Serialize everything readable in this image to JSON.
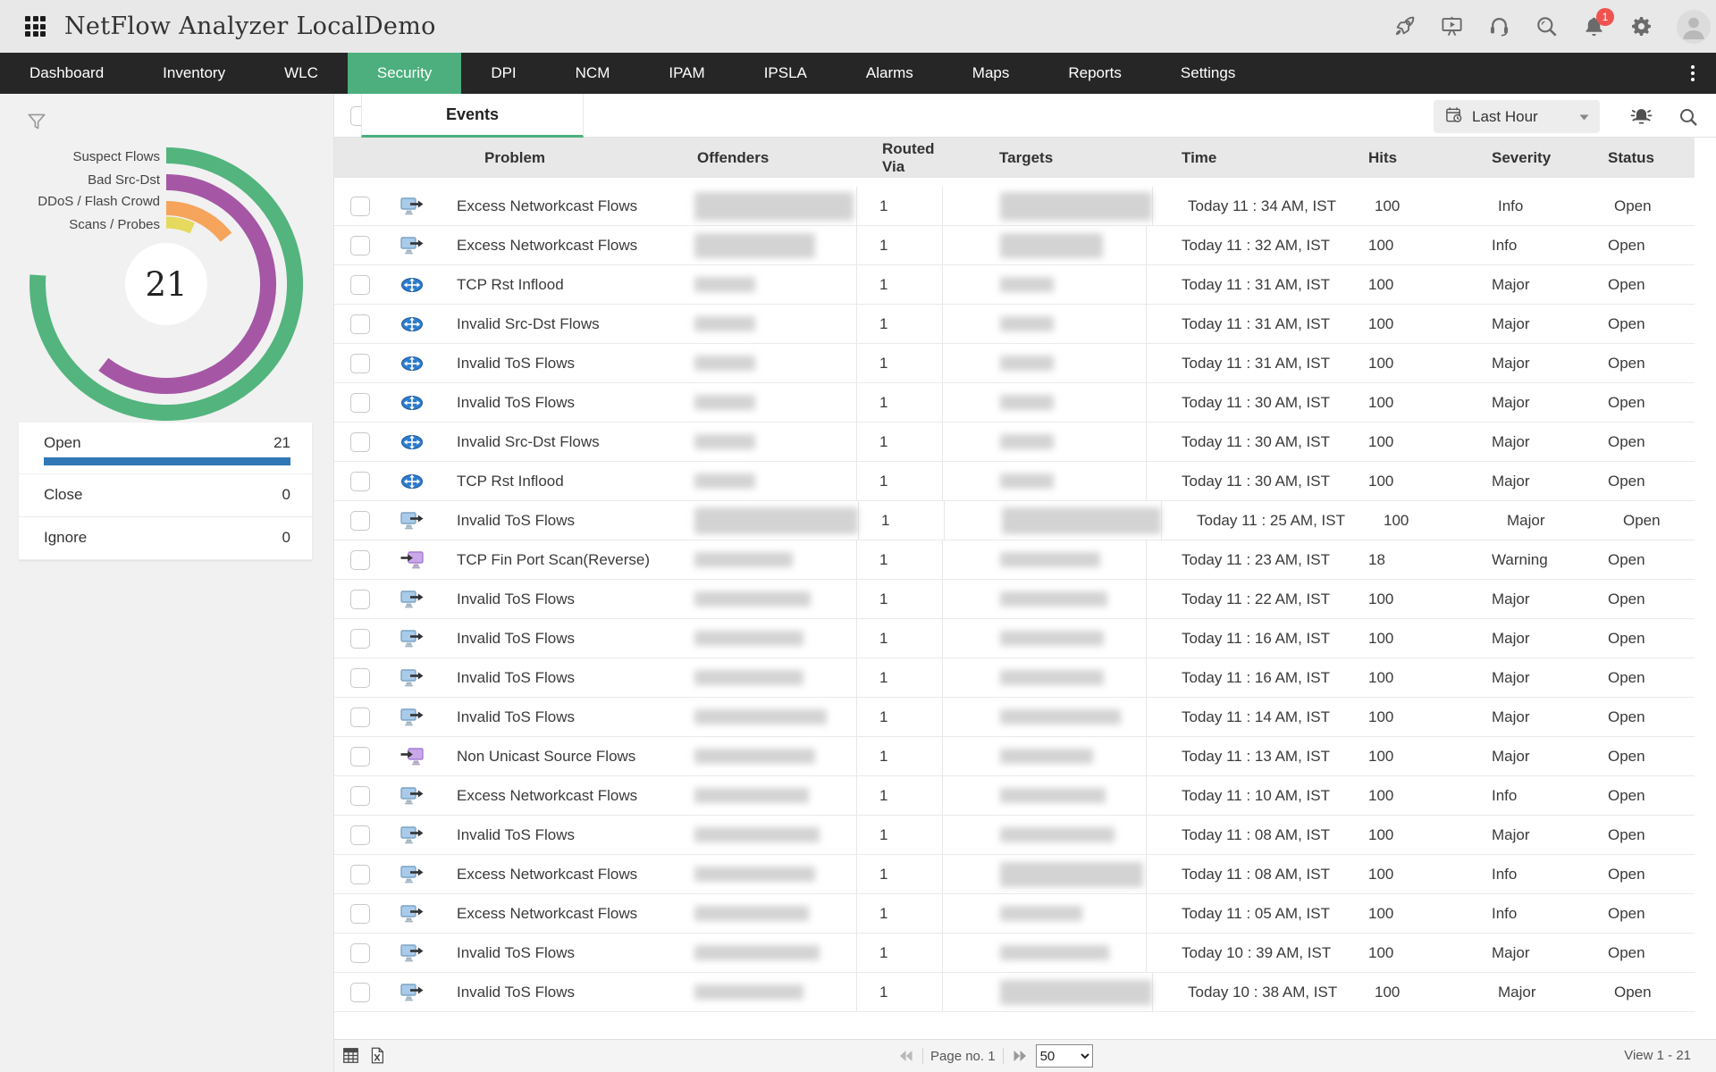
{
  "header": {
    "title": "NetFlow Analyzer LocalDemo",
    "notification_count": "1",
    "icons": [
      "launcher-grid-icon",
      "rocket-icon",
      "demo-player-icon",
      "support-headset-icon",
      "global-search-icon",
      "notifications-bell-icon",
      "settings-gear-icon",
      "user-avatar"
    ]
  },
  "nav": {
    "active_color": "#4caf7d",
    "tabs": [
      {
        "label": "Dashboard",
        "active": false
      },
      {
        "label": "Inventory",
        "active": false
      },
      {
        "label": "WLC",
        "active": false
      },
      {
        "label": "Security",
        "active": true
      },
      {
        "label": "DPI",
        "active": false
      },
      {
        "label": "NCM",
        "active": false
      },
      {
        "label": "IPAM",
        "active": false
      },
      {
        "label": "IPSLA",
        "active": false
      },
      {
        "label": "Alarms",
        "active": false
      },
      {
        "label": "Maps",
        "active": false
      },
      {
        "label": "Reports",
        "active": false
      },
      {
        "label": "Settings",
        "active": false
      }
    ]
  },
  "sidebar": {
    "chart": {
      "type": "radial",
      "total": "21",
      "segments": [
        {
          "label": "Suspect Flows",
          "color": "#53b47e",
          "sweep_deg": 274
        },
        {
          "label": "Bad Src-Dst",
          "color": "#a557a5",
          "sweep_deg": 218
        },
        {
          "label": "DDoS / Flash Crowd",
          "color": "#f6a45c",
          "sweep_deg": 52
        },
        {
          "label": "Scans / Probes",
          "color": "#e5d95e",
          "sweep_deg": 25
        }
      ]
    },
    "status_counts": [
      {
        "label": "Open",
        "value": "21",
        "bar": true,
        "bar_color": "#2f78b5"
      },
      {
        "label": "Close",
        "value": "0",
        "bar": false
      },
      {
        "label": "Ignore",
        "value": "0",
        "bar": false
      }
    ]
  },
  "toolbar": {
    "tab_label": "Events",
    "time_range": "Last Hour"
  },
  "table": {
    "columns": [
      "Problem",
      "Offenders",
      "Routed Via",
      "Targets",
      "Time",
      "Hits",
      "Severity",
      "Status"
    ],
    "rows": [
      {
        "problem": "Excess Networkcast Flows",
        "icon": "host-out",
        "routed_via": "1",
        "time": "Today 11 : 34 AM, IST",
        "hits": "100",
        "severity": "Info",
        "status": "Open",
        "ow": 178,
        "oh": 32,
        "tw": 170,
        "th": 32
      },
      {
        "problem": "Excess Networkcast Flows",
        "icon": "host-out",
        "routed_via": "1",
        "time": "Today 11 : 32 AM, IST",
        "hits": "100",
        "severity": "Info",
        "status": "Open",
        "ow": 135,
        "oh": 28,
        "tw": 115,
        "th": 28
      },
      {
        "problem": "TCP Rst Inflood",
        "icon": "router",
        "routed_via": "1",
        "time": "Today 11 : 31 AM, IST",
        "hits": "100",
        "severity": "Major",
        "status": "Open",
        "ow": 68,
        "oh": 17,
        "tw": 60,
        "th": 17
      },
      {
        "problem": "Invalid Src-Dst Flows",
        "icon": "router",
        "routed_via": "1",
        "time": "Today 11 : 31 AM, IST",
        "hits": "100",
        "severity": "Major",
        "status": "Open",
        "ow": 68,
        "oh": 17,
        "tw": 60,
        "th": 17
      },
      {
        "problem": "Invalid ToS Flows",
        "icon": "router",
        "routed_via": "1",
        "time": "Today 11 : 31 AM, IST",
        "hits": "100",
        "severity": "Major",
        "status": "Open",
        "ow": 68,
        "oh": 17,
        "tw": 60,
        "th": 17
      },
      {
        "problem": "Invalid ToS Flows",
        "icon": "router",
        "routed_via": "1",
        "time": "Today 11 : 30 AM, IST",
        "hits": "100",
        "severity": "Major",
        "status": "Open",
        "ow": 68,
        "oh": 17,
        "tw": 60,
        "th": 17
      },
      {
        "problem": "Invalid Src-Dst Flows",
        "icon": "router",
        "routed_via": "1",
        "time": "Today 11 : 30 AM, IST",
        "hits": "100",
        "severity": "Major",
        "status": "Open",
        "ow": 68,
        "oh": 17,
        "tw": 60,
        "th": 17
      },
      {
        "problem": "TCP Rst Inflood",
        "icon": "router",
        "routed_via": "1",
        "time": "Today 11 : 30 AM, IST",
        "hits": "100",
        "severity": "Major",
        "status": "Open",
        "ow": 68,
        "oh": 17,
        "tw": 60,
        "th": 17
      },
      {
        "problem": "Invalid ToS Flows",
        "icon": "host-out",
        "routed_via": "1",
        "time": "Today 11 : 25 AM, IST",
        "hits": "100",
        "severity": "Major",
        "status": "Open",
        "ow": 183,
        "oh": 30,
        "tw": 178,
        "th": 30
      },
      {
        "problem": "TCP Fin Port Scan(Reverse)",
        "icon": "host-in",
        "routed_via": "1",
        "time": "Today 11 : 23 AM, IST",
        "hits": "18",
        "severity": "Warning",
        "status": "Open",
        "ow": 110,
        "oh": 17,
        "tw": 112,
        "th": 17
      },
      {
        "problem": "Invalid ToS Flows",
        "icon": "host-out",
        "routed_via": "1",
        "time": "Today 11 : 22 AM, IST",
        "hits": "100",
        "severity": "Major",
        "status": "Open",
        "ow": 130,
        "oh": 17,
        "tw": 120,
        "th": 17
      },
      {
        "problem": "Invalid ToS Flows",
        "icon": "host-out",
        "routed_via": "1",
        "time": "Today 11 : 16 AM, IST",
        "hits": "100",
        "severity": "Major",
        "status": "Open",
        "ow": 122,
        "oh": 17,
        "tw": 116,
        "th": 17
      },
      {
        "problem": "Invalid ToS Flows",
        "icon": "host-out",
        "routed_via": "1",
        "time": "Today 11 : 16 AM, IST",
        "hits": "100",
        "severity": "Major",
        "status": "Open",
        "ow": 122,
        "oh": 17,
        "tw": 116,
        "th": 17
      },
      {
        "problem": "Invalid ToS Flows",
        "icon": "host-out",
        "routed_via": "1",
        "time": "Today 11 : 14 AM, IST",
        "hits": "100",
        "severity": "Major",
        "status": "Open",
        "ow": 148,
        "oh": 17,
        "tw": 135,
        "th": 17
      },
      {
        "problem": "Non Unicast Source Flows",
        "icon": "host-in",
        "routed_via": "1",
        "time": "Today 11 : 13 AM, IST",
        "hits": "100",
        "severity": "Major",
        "status": "Open",
        "ow": 135,
        "oh": 17,
        "tw": 104,
        "th": 17
      },
      {
        "problem": "Excess Networkcast Flows",
        "icon": "host-out",
        "routed_via": "1",
        "time": "Today 11 : 10 AM, IST",
        "hits": "100",
        "severity": "Info",
        "status": "Open",
        "ow": 128,
        "oh": 17,
        "tw": 118,
        "th": 17
      },
      {
        "problem": "Invalid ToS Flows",
        "icon": "host-out",
        "routed_via": "1",
        "time": "Today 11 : 08 AM, IST",
        "hits": "100",
        "severity": "Major",
        "status": "Open",
        "ow": 140,
        "oh": 17,
        "tw": 128,
        "th": 17
      },
      {
        "problem": "Excess Networkcast Flows",
        "icon": "host-out",
        "routed_via": "1",
        "time": "Today 11 : 08 AM, IST",
        "hits": "100",
        "severity": "Info",
        "status": "Open",
        "ow": 135,
        "oh": 17,
        "tw": 160,
        "th": 28
      },
      {
        "problem": "Excess Networkcast Flows",
        "icon": "host-out",
        "routed_via": "1",
        "time": "Today 11 : 05 AM, IST",
        "hits": "100",
        "severity": "Info",
        "status": "Open",
        "ow": 128,
        "oh": 17,
        "tw": 92,
        "th": 17
      },
      {
        "problem": "Invalid ToS Flows",
        "icon": "host-out",
        "routed_via": "1",
        "time": "Today 10 : 39 AM, IST",
        "hits": "100",
        "severity": "Major",
        "status": "Open",
        "ow": 140,
        "oh": 17,
        "tw": 122,
        "th": 17
      },
      {
        "problem": "Invalid ToS Flows",
        "icon": "host-out",
        "routed_via": "1",
        "time": "Today 10 : 38 AM, IST",
        "hits": "100",
        "severity": "Major",
        "status": "Open",
        "ow": 122,
        "oh": 17,
        "tw": 170,
        "th": 28
      }
    ]
  },
  "footer": {
    "export_icons": [
      "table-export-icon",
      "excel-export-icon"
    ],
    "page_label": "Page no. 1",
    "page_size": "50",
    "view_label": "View 1 - 21"
  }
}
